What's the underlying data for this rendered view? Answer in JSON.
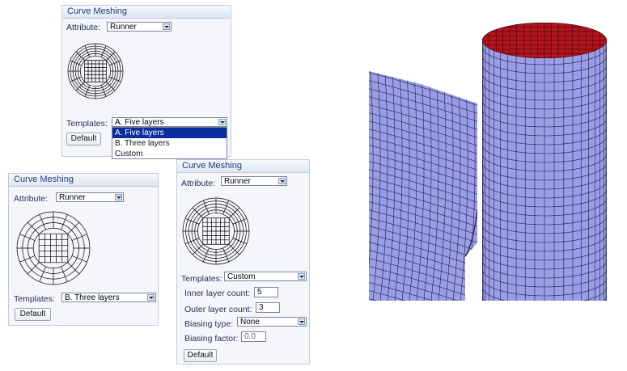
{
  "panel_a": {
    "title": "Curve Meshing",
    "attribute_label": "Attribute:",
    "attribute_value": "Runner",
    "templates_label": "Templates:",
    "templates_value": "A. Five layers",
    "dropdown_options": [
      "A. Five layers",
      "B. Three layers",
      "Custom"
    ],
    "dropdown_selected_index": 0,
    "default_button": "Default"
  },
  "panel_b": {
    "title": "Curve Meshing",
    "attribute_label": "Attribute:",
    "attribute_value": "Runner",
    "templates_label": "Templates:",
    "templates_value": "B. Three layers",
    "default_button": "Default"
  },
  "panel_c": {
    "title": "Curve Meshing",
    "attribute_label": "Attribute:",
    "attribute_value": "Runner",
    "templates_label": "Templates:",
    "templates_value": "Custom",
    "inner_layer_label": "Inner layer count:",
    "inner_layer_value": "5",
    "outer_layer_label": "Outer layer count:",
    "outer_layer_value": "3",
    "biasing_type_label": "Biasing type:",
    "biasing_type_value": "None",
    "biasing_factor_label": "Biasing factor:",
    "biasing_factor_value": "0.0",
    "default_button": "Default"
  },
  "colors": {
    "pipe_fill": "#9a9ee6",
    "pipe_edge": "#1e2048",
    "cap_fill": "#b0141c",
    "selection": "#0a2e9e"
  }
}
